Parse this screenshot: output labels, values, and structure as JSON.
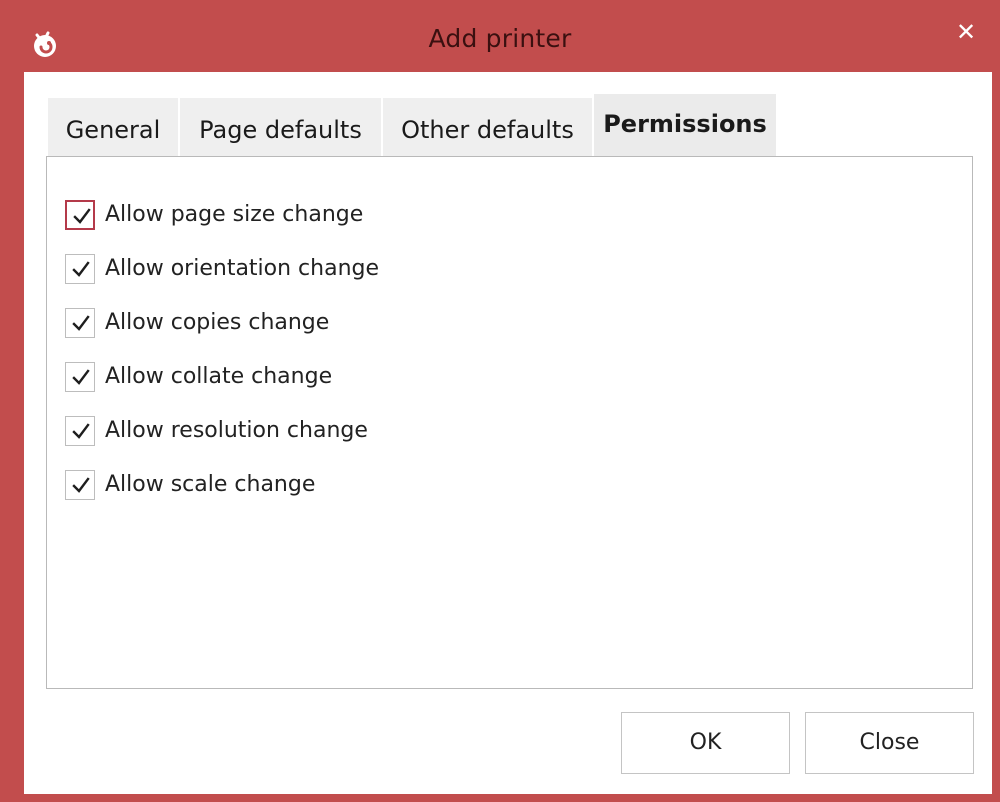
{
  "window": {
    "title": "Add printer",
    "close_glyph": "✕",
    "app_icon": "app-logo-icon",
    "frame_color": "#c24d4d"
  },
  "tabs": [
    {
      "label": "General"
    },
    {
      "label": "Page defaults"
    },
    {
      "label": "Other defaults"
    },
    {
      "label": "Permissions",
      "active": true
    }
  ],
  "permissions": [
    {
      "label": "Allow page size change",
      "checked": true
    },
    {
      "label": "Allow orientation change",
      "checked": true
    },
    {
      "label": "Allow copies change",
      "checked": true
    },
    {
      "label": "Allow collate change",
      "checked": true
    },
    {
      "label": "Allow resolution change",
      "checked": true
    },
    {
      "label": "Allow scale change",
      "checked": true
    }
  ],
  "buttons": {
    "ok_label": "OK",
    "close_label": "Close"
  }
}
